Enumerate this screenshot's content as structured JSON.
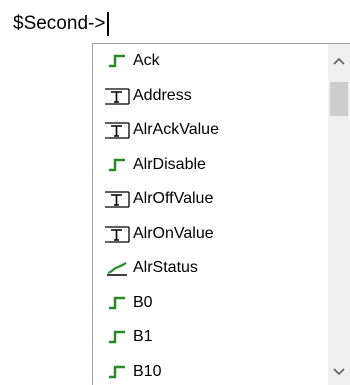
{
  "editor": {
    "text": "$Second->"
  },
  "autocomplete": {
    "items": [
      {
        "label": "Ack",
        "icon": "digital-tag-icon"
      },
      {
        "label": "Address",
        "icon": "text-tag-icon"
      },
      {
        "label": "AlrAckValue",
        "icon": "text-tag-icon"
      },
      {
        "label": "AlrDisable",
        "icon": "digital-tag-icon"
      },
      {
        "label": "AlrOffValue",
        "icon": "text-tag-icon"
      },
      {
        "label": "AlrOnValue",
        "icon": "text-tag-icon"
      },
      {
        "label": "AlrStatus",
        "icon": "analog-tag-icon"
      },
      {
        "label": "B0",
        "icon": "digital-tag-icon"
      },
      {
        "label": "B1",
        "icon": "digital-tag-icon"
      },
      {
        "label": "B10",
        "icon": "digital-tag-icon"
      }
    ]
  },
  "scrollbar": {
    "position": 0.0
  },
  "colors": {
    "digital_icon": "#2a8a2a",
    "analog_icon": "#2a8a2a",
    "text_icon": "#000000",
    "scroll_track": "#f0f0f0",
    "scroll_thumb": "#cdcdcd"
  }
}
